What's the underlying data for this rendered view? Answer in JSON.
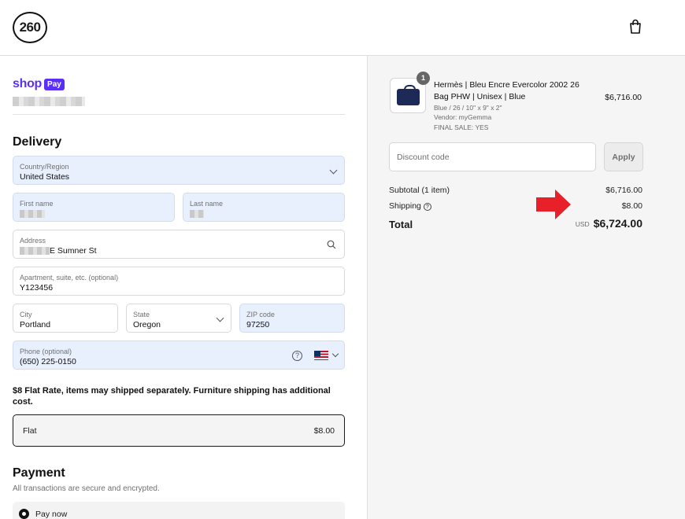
{
  "header": {
    "logo_text": "260",
    "cart_icon": "shopping-bag-icon"
  },
  "contact": {
    "shop_label": "shop",
    "pay_label": "Pay"
  },
  "delivery": {
    "title": "Delivery",
    "country": {
      "label": "Country/Region",
      "value": "United States"
    },
    "first_name": {
      "label": "First name",
      "value": ""
    },
    "last_name": {
      "label": "Last name",
      "value": ""
    },
    "address": {
      "label": "Address",
      "value": "E Sumner St"
    },
    "apartment": {
      "label": "Apartment, suite, etc. (optional)",
      "value": "Y123456"
    },
    "city": {
      "label": "City",
      "value": "Portland"
    },
    "state": {
      "label": "State",
      "value": "Oregon"
    },
    "zip": {
      "label": "ZIP code",
      "value": "97250"
    },
    "phone": {
      "label": "Phone (optional)",
      "value": "(650) 225-0150"
    }
  },
  "shipping": {
    "note": "$8 Flat Rate, items may shipped separately. Furniture shipping has additional cost.",
    "option_name": "Flat",
    "option_price": "$8.00"
  },
  "payment": {
    "title": "Payment",
    "subtitle": "All transactions are secure and encrypted.",
    "option_label": "Pay now"
  },
  "order": {
    "quantity_badge": "1",
    "product_name": "Hermès | Bleu Encre Evercolor 2002 26 Bag PHW | Unisex | Blue",
    "variant": "Blue / 26 / 10\" x 9\" x 2\"",
    "vendor": "Vendor: myGemma",
    "final_sale": "FINAL SALE: YES",
    "price": "$6,716.00",
    "discount_placeholder": "Discount code",
    "apply_label": "Apply",
    "subtotal_label": "Subtotal (1 item)",
    "subtotal_value": "$6,716.00",
    "shipping_label": "Shipping",
    "shipping_value": "$8.00",
    "total_label": "Total",
    "currency": "USD",
    "total_value": "$6,724.00"
  },
  "colors": {
    "shop_pay_purple": "#5a31f4",
    "autofill_blue": "#e8f0fe",
    "arrow_red": "#e8202a"
  }
}
